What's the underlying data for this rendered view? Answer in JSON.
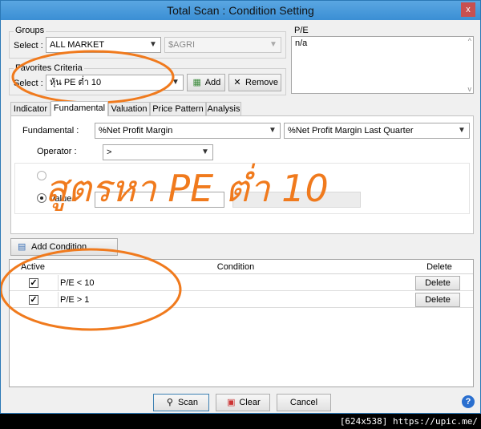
{
  "window": {
    "title": "Total Scan : Condition Setting",
    "close_glyph": "x"
  },
  "groups": {
    "label": "Groups",
    "select_label": "Select :",
    "market_value": "ALL MARKET",
    "sector_value": "$AGRI"
  },
  "pe_box": {
    "label": "P/E",
    "value": "n/a"
  },
  "favorites": {
    "label": "Favorites Criteria",
    "select_label": "Select :",
    "value": "หุ้น PE ต่ำ 10",
    "add_label": "Add",
    "remove_label": "Remove"
  },
  "tabs": [
    "Indicator",
    "Fundamental",
    "Valuation",
    "Price Pattern",
    "Analysis"
  ],
  "fundamental": {
    "label": "Fundamental :",
    "field_value": "%Net Profit Margin",
    "compare_value": "%Net Profit Margin Last Quarter",
    "operator_label": "Operator :",
    "operator_value": ">",
    "value_label": "Value :"
  },
  "add_condition_label": "Add Condition",
  "conditions_table": {
    "headers": {
      "active": "Active",
      "condition": "Condition",
      "delete": "Delete"
    },
    "rows": [
      {
        "active": true,
        "condition": "P/E < 10",
        "delete_label": "Delete"
      },
      {
        "active": true,
        "condition": "P/E > 1",
        "delete_label": "Delete"
      }
    ]
  },
  "footer": {
    "scan_label": "Scan",
    "clear_label": "Clear",
    "cancel_label": "Cancel",
    "help_glyph": "?"
  },
  "annotation": {
    "text": "สูตรหา PE ต่ำ 10",
    "color": "#f07a1d"
  },
  "statusbar": {
    "text": "[624x538] https://upic.me/"
  },
  "icons": {
    "add": "add-criteria-icon",
    "remove": "remove-x-icon",
    "add_condition": "add-condition-icon",
    "scan": "magnifier-icon",
    "clear": "eraser-icon",
    "help": "help-icon"
  }
}
